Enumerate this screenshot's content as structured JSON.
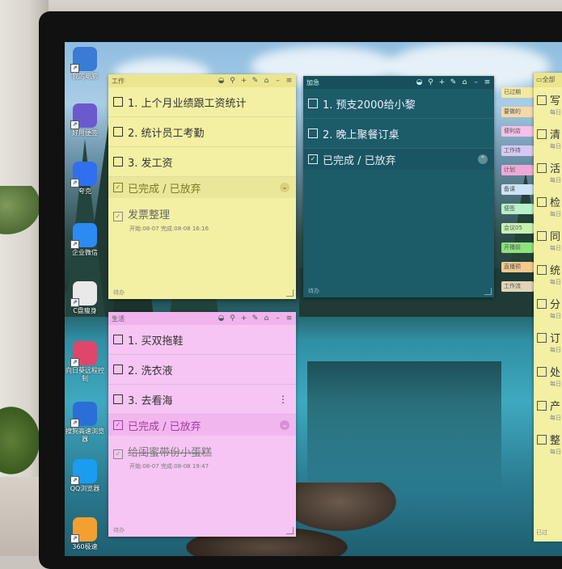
{
  "desktop_icons": [
    {
      "name": "我的电脑",
      "color": "#3a7bd5"
    },
    {
      "name": "好用便签",
      "color": "#6a5acd"
    },
    {
      "name": "夸克",
      "color": "#2f6ff0"
    },
    {
      "name": "企业微信",
      "color": "#2c8af3"
    },
    {
      "name": "C盘瘦身",
      "color": "#e9e9e9"
    },
    {
      "name": "向日葵远程控制",
      "color": "#e0466b"
    },
    {
      "name": "搜狗高速浏览器",
      "color": "#2a6fd8"
    },
    {
      "name": "QQ浏览器",
      "color": "#1a9cf0"
    },
    {
      "name": "360极速",
      "color": "#f2a030"
    }
  ],
  "note_work": {
    "title": "工作",
    "items": [
      "1. 上个月业绩跟工资统计",
      "2. 统计员工考勤",
      "3. 发工资"
    ],
    "section": "已完成 / 已放弃",
    "done": {
      "text": "发票整理",
      "meta": "开始:08-07  完成:08-08 16:16"
    },
    "footer": "待办"
  },
  "note_urgent": {
    "title": "加急",
    "items": [
      "1. 预支2000给小黎",
      "2. 晚上聚餐订桌"
    ],
    "section": "已完成 / 已放弃",
    "footer": "待办"
  },
  "note_life": {
    "title": "生活",
    "items": [
      "1. 买双拖鞋",
      "2. 洗衣液",
      "3. 去看海"
    ],
    "section": "已完成 / 已放弃",
    "done": {
      "text": "给闺蜜带份小蛋糕",
      "meta": "开始:08-07  完成:08-08 19:47"
    },
    "footer": "待办"
  },
  "tags": [
    {
      "label": "已过期",
      "color": "#f5e9a0"
    },
    {
      "label": "要做的",
      "color": "#f3d9a8"
    },
    {
      "label": "便利店",
      "color": "#f5c1e8"
    },
    {
      "label": "工作待",
      "color": "#d6c8f2"
    },
    {
      "label": "计划",
      "color": "#f0a8d8"
    },
    {
      "label": "备课",
      "color": "#cde3f7"
    },
    {
      "label": "便签",
      "color": "#b8f0c8"
    },
    {
      "label": "会议05",
      "color": "#c9f2b1"
    },
    {
      "label": "开播前",
      "color": "#8fe37b"
    },
    {
      "label": "直播预",
      "color": "#f5c98a"
    },
    {
      "label": "工作流",
      "color": "#e2d4b5"
    }
  ],
  "right_panel": {
    "header": "全部",
    "items": [
      {
        "t": "写",
        "s": "每日"
      },
      {
        "t": "清",
        "s": "每日"
      },
      {
        "t": "活",
        "s": "每日"
      },
      {
        "t": "检",
        "s": "每日"
      },
      {
        "t": "同",
        "s": "每日"
      },
      {
        "t": "统",
        "s": "每日"
      },
      {
        "t": "分",
        "s": "每日"
      },
      {
        "t": "订",
        "s": "每日"
      },
      {
        "t": "处",
        "s": "每日"
      },
      {
        "t": "产",
        "s": "每日"
      },
      {
        "t": "整",
        "s": "每日"
      }
    ],
    "footer": "已过"
  }
}
